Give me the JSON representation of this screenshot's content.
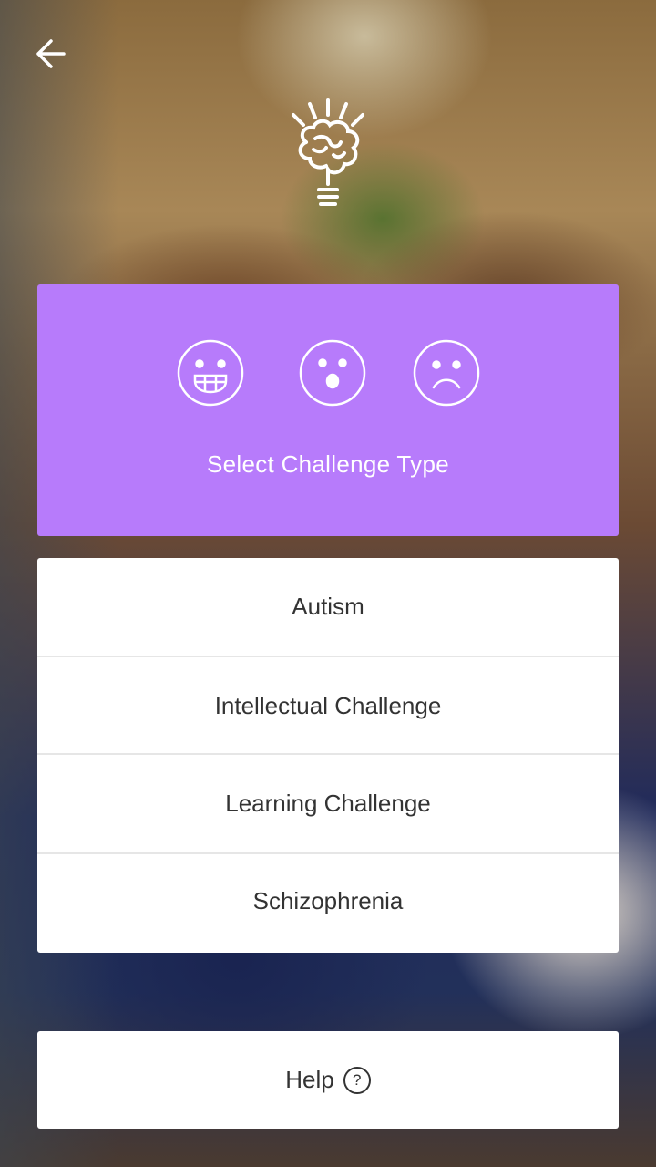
{
  "header": {
    "back_icon": "arrow-left-icon",
    "logo_icon": "lightbulb-brain-icon"
  },
  "challenge_card": {
    "background_color": "#b77bfb",
    "icons": [
      "grinning-face-icon",
      "surprised-face-icon",
      "sad-face-icon"
    ],
    "title": "Select Challenge Type"
  },
  "challenge_list": {
    "items": [
      {
        "label": "Autism"
      },
      {
        "label": "Intellectual Challenge"
      },
      {
        "label": "Learning Challenge"
      },
      {
        "label": "Schizophrenia"
      }
    ]
  },
  "help": {
    "label": "Help",
    "icon_glyph": "?"
  }
}
